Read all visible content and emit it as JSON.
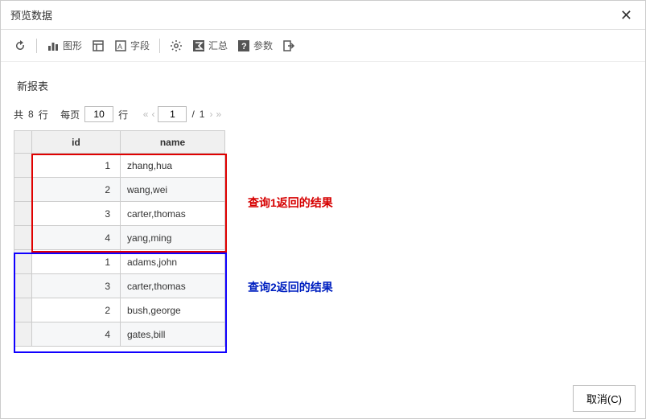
{
  "window": {
    "title": "预览数据"
  },
  "toolbar": {
    "chart_label": "图形",
    "field_label": "字段",
    "summary_label": "汇总",
    "param_label": "参数"
  },
  "report": {
    "name": "新报表"
  },
  "pager": {
    "total_prefix": "共",
    "total_rows": "8",
    "rows_unit": "行",
    "per_page_label": "每页",
    "per_page_value": "10",
    "page_unit": "行",
    "current_page": "1",
    "total_pages": "1"
  },
  "columns": {
    "id": "id",
    "name": "name"
  },
  "rows": [
    {
      "id": "1",
      "name": "zhang,hua"
    },
    {
      "id": "2",
      "name": "wang,wei"
    },
    {
      "id": "3",
      "name": "carter,thomas"
    },
    {
      "id": "4",
      "name": "yang,ming"
    },
    {
      "id": "1",
      "name": "adams,john"
    },
    {
      "id": "3",
      "name": "carter,thomas"
    },
    {
      "id": "2",
      "name": "bush,george"
    },
    {
      "id": "4",
      "name": "gates,bill"
    }
  ],
  "annotations": {
    "query1": "查询1返回的结果",
    "query2": "查询2返回的结果"
  },
  "footer": {
    "cancel": "取消(C)"
  }
}
